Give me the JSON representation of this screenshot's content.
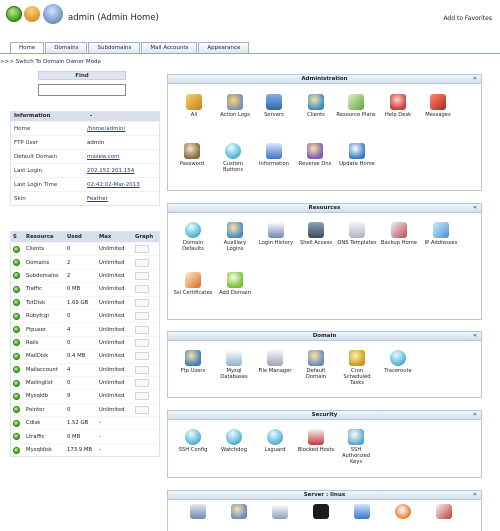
{
  "header": {
    "title": "admin (Admin Home)",
    "favorites_link": "Add to Favorites"
  },
  "tabs": [
    "Home",
    "Domains",
    "Subdomains",
    "Mail Accounts",
    "Appearance"
  ],
  "switch_link": ">>> Switch To Domain Owner Mode",
  "find": {
    "label": "Find",
    "value": ""
  },
  "information": {
    "header": "Information",
    "header_dash": "-",
    "rows": [
      {
        "label": "Home",
        "value": "/home/admin/"
      },
      {
        "label": "FTP User",
        "value": "admin"
      },
      {
        "label": "Default Domain",
        "value": "masew.com"
      },
      {
        "label": "Last Login",
        "value": "202.152.201.154"
      },
      {
        "label": "Last Login Time",
        "value": "02:42:02-Mar-2013"
      },
      {
        "label": "Skin",
        "value": "Feather"
      }
    ]
  },
  "resources_table": {
    "headers": [
      "S",
      "Resource",
      "Used",
      "Max",
      "Graph"
    ],
    "rows": [
      {
        "resource": "Clients",
        "used": "0",
        "max": "Unlimited",
        "graph": true
      },
      {
        "resource": "Domains",
        "used": "2",
        "max": "Unlimited",
        "graph": true
      },
      {
        "resource": "Subdomains",
        "used": "2",
        "max": "Unlimited",
        "graph": true
      },
      {
        "resource": "Traffic",
        "used": "0 MB",
        "max": "Unlimited",
        "graph": true
      },
      {
        "resource": "TotDisk",
        "used": "1.69 GB",
        "max": "Unlimited",
        "graph": true
      },
      {
        "resource": "Rubyfcgi",
        "used": "0",
        "max": "Unlimited",
        "graph": true
      },
      {
        "resource": "Ftpuser",
        "used": "4",
        "max": "Unlimited",
        "graph": true
      },
      {
        "resource": "Rails",
        "used": "0",
        "max": "Unlimited",
        "graph": true
      },
      {
        "resource": "MailDisk",
        "used": "0.4 MB",
        "max": "Unlimited",
        "graph": true
      },
      {
        "resource": "Mailaccount",
        "used": "4",
        "max": "Unlimited",
        "graph": true
      },
      {
        "resource": "Mailinglist",
        "used": "0",
        "max": "Unlimited",
        "graph": true
      },
      {
        "resource": "Mysqldb",
        "used": "9",
        "max": "Unlimited",
        "graph": true
      },
      {
        "resource": "Pointer",
        "used": "0",
        "max": "Unlimited",
        "graph": true
      },
      {
        "resource": "Cdisk",
        "used": "1.52 GB",
        "max": "-",
        "graph": false
      },
      {
        "resource": "Ltraffic",
        "used": "0 MB",
        "max": "-",
        "graph": false
      },
      {
        "resource": "Mysqldisk",
        "used": "173.9 MB",
        "max": "-",
        "graph": false
      }
    ]
  },
  "panels": {
    "administration": {
      "title": "Administration",
      "items": [
        "All",
        "Action Logs",
        "Servers",
        "Clients",
        "Resource Plans",
        "Help Desk",
        "Messages",
        "Password",
        "Custom Buttons",
        "Information",
        "Reverse Dns",
        "Update Home"
      ]
    },
    "resources": {
      "title": "Resources",
      "items": [
        "Domain Defaults",
        "Auxiliary Logins",
        "Login History",
        "Shell Access",
        "DNS Templates",
        "Backup Home",
        "IP Addresses",
        "Ssl Certificates",
        "Add Domain"
      ]
    },
    "domain": {
      "title": "Domain",
      "items": [
        "Ftp Users",
        "Mysql Databases",
        "File Manager",
        "Default Domain",
        "Cron Scheduled Tasks",
        "Traceroute"
      ]
    },
    "security": {
      "title": "Security",
      "items": [
        "SSH Config",
        "Watchdog",
        "Lxguard",
        "Blocked Hosts",
        "SSH Authorized Keys"
      ]
    },
    "server": {
      "title": "Server : linux"
    }
  }
}
